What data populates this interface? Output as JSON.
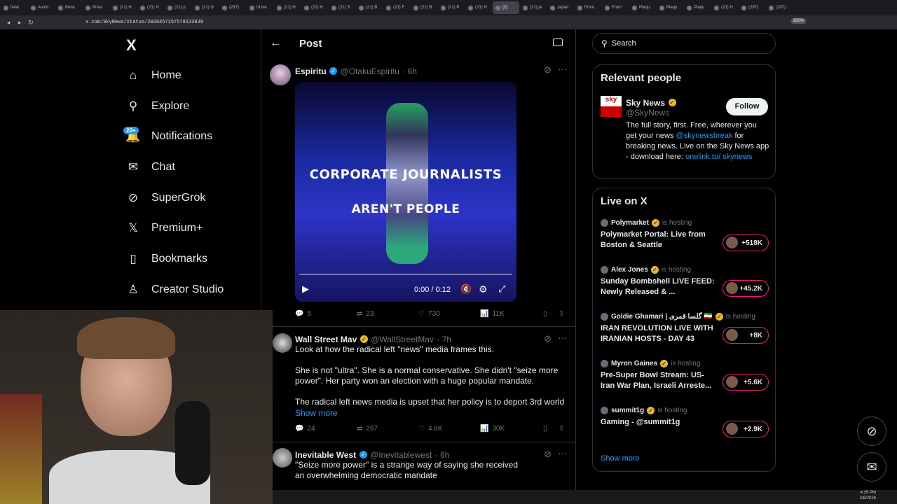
{
  "browser": {
    "tabs": [
      "New",
      "Asmo",
      "Presi",
      "Presi",
      "(21) H",
      "(21) H",
      "(21) p",
      "(21) G",
      "(297)",
      "r/Live",
      "(21) H",
      "(21) H",
      "(21) S",
      "(21) B",
      "(21) F",
      "(21) B",
      "(21) P",
      "(21) H",
      "(2)",
      "(21) ja",
      "Japan",
      "From",
      "From",
      "Plaqu",
      "Plaqu",
      "Plaqu",
      "(21) H",
      "(297)",
      "(297)"
    ],
    "url": "x.com/SkyNews/status/2020457157578133939",
    "zoom": "150%"
  },
  "sidebar": {
    "logo": "X",
    "items": [
      {
        "label": "Home",
        "icon": "home-icon",
        "glyph": "⌂"
      },
      {
        "label": "Explore",
        "icon": "search-icon",
        "glyph": "⚲"
      },
      {
        "label": "Notifications",
        "icon": "bell-icon",
        "glyph": "🔔"
      },
      {
        "label": "Chat",
        "icon": "mail-icon",
        "glyph": "✉"
      },
      {
        "label": "SuperGrok",
        "icon": "grok-icon",
        "glyph": "⊘"
      },
      {
        "label": "Premium+",
        "icon": "x-logo-icon",
        "glyph": "𝕏"
      },
      {
        "label": "Bookmarks",
        "icon": "bookmark-icon",
        "glyph": "▯"
      },
      {
        "label": "Creator Studio",
        "icon": "creator-icon",
        "glyph": "♙"
      }
    ],
    "notif_badge": "20+"
  },
  "header": {
    "title": "Post"
  },
  "tweets": [
    {
      "name": "Espiritu",
      "handle": "@OtakuEspiritu",
      "time": "· 6h",
      "video": {
        "line1": "CORPORATE JOURNALISTS",
        "line2": "AREN'T PEOPLE",
        "time": "0:00 / 0:12"
      },
      "replies": "5",
      "reposts": "23",
      "likes": "730",
      "views": "11K"
    },
    {
      "name": "Wall Street Mav",
      "handle": "@WallStreetMav",
      "time": "· 7h",
      "text1": "Look at how the radical left \"news\" media frames this.",
      "text2": "She is not \"ultra\". She is a normal conservative. She didn't \"seize more power\". Her party won an election with a huge popular mandate.",
      "text3": "The radical left news media is upset that her policy is to deport 3rd world",
      "show_more": "Show more",
      "replies": "24",
      "reposts": "267",
      "likes": "4.6K",
      "views": "30K"
    },
    {
      "name": "Inevitable West",
      "handle": "@Inevitablewest",
      "time": "· 6h",
      "text1": "\"Seize more power\" is a strange way of saying she received an overwhelming democratic mandate"
    }
  ],
  "search": {
    "placeholder": "Search"
  },
  "relevant": {
    "title": "Relevant people",
    "name": "Sky News",
    "handle": "@SkyNews",
    "follow": "Follow",
    "bio_pre": "The full story, first. Free, wherever you get your news ",
    "bio_link1": "@skynewsbreak",
    "bio_mid": " for breaking news. Live on the Sky News app - download here: ",
    "bio_link2": "onelink.to/ skynews"
  },
  "live": {
    "title": "Live on X",
    "hosting": "is hosting",
    "items": [
      {
        "host": "Polymarket",
        "title": "Polymarket Portal: Live from Boston & Seattle",
        "count": "+518K"
      },
      {
        "host": "Alex Jones",
        "title": "Sunday Bombshell LIVE FEED: Newly Released & ...",
        "count": "+45.2K"
      },
      {
        "host": "Goldie Ghamari | گلسا قمری 🇮🇷",
        "title": "IRAN REVOLUTION LIVE WITH IRANIAN HOSTS - DAY 43",
        "count": "+8K"
      },
      {
        "host": "Myron Gaines",
        "title": "Pre-Super Bowl Stream: US-Iran War Plan, Israeli Arreste...",
        "count": "+5.6K"
      },
      {
        "host": "summit1g",
        "title": "Gaming - @summit1g",
        "count": "+2.9K"
      }
    ],
    "show_more": "Show more"
  },
  "taskbar": {
    "time": "4:39 PM",
    "date": "2/8/2026"
  },
  "colors": {
    "accent": "#1d9bf0",
    "live": "#f91880",
    "bg": "#000000"
  }
}
